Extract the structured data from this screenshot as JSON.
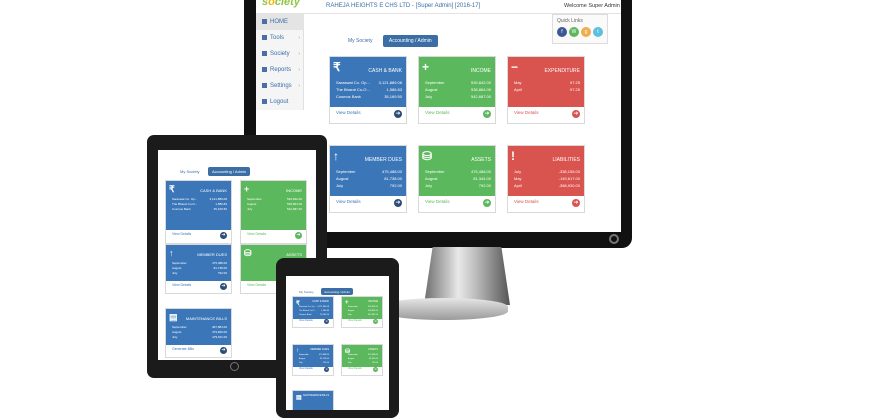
{
  "monitor": {
    "logo": {
      "pre": "s",
      "o": "o",
      "post": "ciety"
    },
    "company": "RAHEJA HEIGHTS E CHS LTD - [Super Admin]   [2016-17]",
    "welcome": "Welcome Super Admin",
    "nav": [
      {
        "label": "HOME",
        "icon": "home-icon"
      },
      {
        "label": "Tools",
        "icon": "wrench-icon"
      },
      {
        "label": "Society",
        "icon": "building-icon"
      },
      {
        "label": "Reports",
        "icon": "report-icon"
      },
      {
        "label": "Settings",
        "icon": "gear-icon"
      },
      {
        "label": "Logout",
        "icon": "logout-icon"
      }
    ],
    "tabs": [
      "My Society",
      "Accounting / Admin"
    ],
    "quick_links": {
      "label": "Quick Links",
      "buttons": [
        "f",
        "W",
        "g",
        "t"
      ],
      "colors": [
        "#3b5998",
        "#5cb85c",
        "#f0ad4e",
        "#5bc0de"
      ]
    },
    "cards": [
      {
        "title": "CASH & BANK",
        "glyph": "₹",
        "color": "blue",
        "rows": [
          [
            "Saraswat Co. Op...",
            "3,121,889.08"
          ],
          [
            "The Bharat Co-O...",
            "1,586.83"
          ],
          [
            "Cosmos Bank",
            "35,169.50"
          ]
        ]
      },
      {
        "title": "INCOME",
        "glyph": "+",
        "color": "green",
        "rows": [
          [
            "September",
            "539,842.00"
          ],
          [
            "August",
            "538,864.00"
          ],
          [
            "July",
            "542,687.00"
          ]
        ]
      },
      {
        "title": "EXPENDITURE",
        "glyph": "−",
        "color": "red",
        "rows": [
          [
            "May",
            "97.25"
          ],
          [
            "April",
            "97.25"
          ]
        ]
      },
      {
        "title": "MEMBER DUES",
        "glyph": "↑",
        "color": "blue",
        "rows": [
          [
            "September",
            "475,488.00"
          ],
          [
            "August",
            "81,738.00"
          ],
          [
            "July",
            "792.00"
          ]
        ]
      },
      {
        "title": "ASSETS",
        "glyph": "⛁",
        "color": "green",
        "rows": [
          [
            "September",
            "475,488.00"
          ],
          [
            "August",
            "81,344.00"
          ],
          [
            "July",
            "792.00"
          ]
        ]
      },
      {
        "title": "LIABILITIES",
        "glyph": "!",
        "color": "red",
        "rows": [
          [
            "July",
            "-338,155.00"
          ],
          [
            "May",
            "-149,617.00"
          ],
          [
            "April",
            "-368,930.00"
          ]
        ]
      }
    ],
    "footer_label": "View Details"
  },
  "tablet": {
    "tabs": [
      "My Society",
      "Accounting / Admin"
    ],
    "cards": [
      {
        "title": "CASH & BANK",
        "glyph": "₹",
        "color": "blue",
        "rows": [
          [
            "Saraswat Co. Op...",
            "3,121,889.08"
          ],
          [
            "The Bharat Co-O...",
            "1,586.83"
          ],
          [
            "Cosmos Bank",
            "35,169.50"
          ]
        ]
      },
      {
        "title": "INCOME",
        "glyph": "+",
        "color": "green",
        "rows": [
          [
            "September",
            "539,842.00"
          ],
          [
            "August",
            "538,864.00"
          ],
          [
            "July",
            "542,687.00"
          ]
        ]
      },
      {
        "title": "MEMBER DUES",
        "glyph": "↑",
        "color": "blue",
        "rows": [
          [
            "September",
            "475,488.00"
          ],
          [
            "August",
            "81,738.00"
          ],
          [
            "July",
            "792.00"
          ]
        ]
      },
      {
        "title": "ASSETS",
        "glyph": "⛁",
        "color": "green",
        "rows": []
      },
      {
        "title": "MAINTENANCE BILLS",
        "glyph": "▤",
        "color": "blue",
        "rows": [
          [
            "September",
            "487,884.00"
          ],
          [
            "August",
            "479,820.00"
          ],
          [
            "July",
            "479,811.00"
          ]
        ]
      }
    ],
    "footer_label": "View Details",
    "footer_label_bills": "Generate Bills"
  },
  "phone": {
    "tabs": [
      "My Society",
      "Accounting / Admin"
    ],
    "cards": [
      {
        "title": "CASH & BANK",
        "glyph": "₹",
        "color": "blue",
        "rows": [
          [
            "Saraswat Co. Op...",
            "3,121,889.08"
          ],
          [
            "The Bharat Co-O...",
            "1,586.83"
          ],
          [
            "Cosmos Bank",
            "35,169.50"
          ]
        ]
      },
      {
        "title": "INCOME",
        "glyph": "+",
        "color": "green",
        "rows": [
          [
            "September",
            "539,842.00"
          ],
          [
            "August",
            "538,864.00"
          ],
          [
            "July",
            "542,687.00"
          ]
        ]
      },
      {
        "title": "MEMBER DUES",
        "glyph": "↑",
        "color": "blue",
        "rows": [
          [
            "September",
            "475,488.00"
          ],
          [
            "August",
            "81,738.00"
          ],
          [
            "July",
            "792.00"
          ]
        ]
      },
      {
        "title": "ASSETS",
        "glyph": "⛁",
        "color": "green",
        "rows": [
          [
            "September",
            "475,488.00"
          ],
          [
            "August",
            "81,344.00"
          ],
          [
            "July",
            "792.00"
          ]
        ]
      },
      {
        "title": "MAINTENANCE BILLS",
        "glyph": "▤",
        "color": "blue",
        "rows": []
      }
    ],
    "footer_label": "View Details"
  },
  "colors": {
    "blue": "#3a76b8",
    "green": "#5cb85c",
    "red": "#d9534f"
  }
}
